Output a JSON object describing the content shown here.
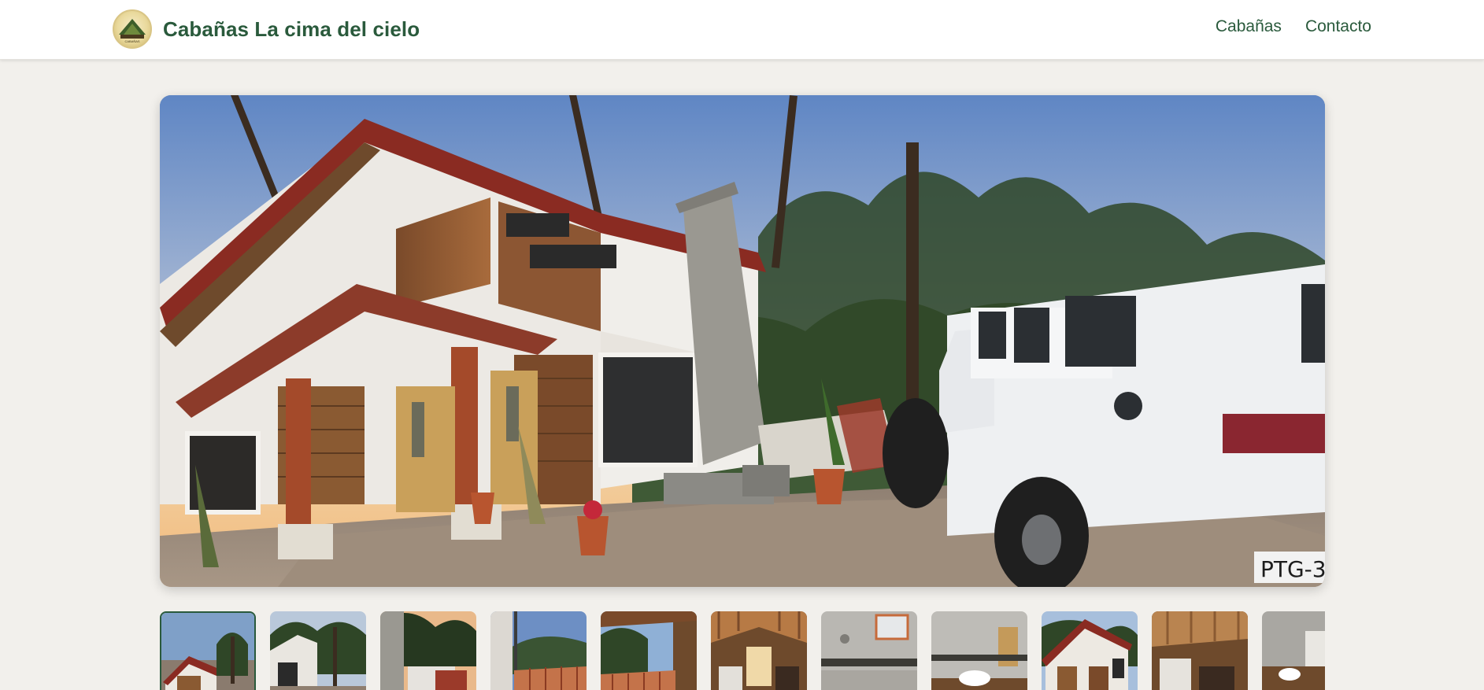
{
  "header": {
    "brand_name": "Cabañas La cima del cielo",
    "logo_text": "CABAÑAS",
    "nav": [
      {
        "label": "Cabañas"
      },
      {
        "label": "Contacto"
      }
    ]
  },
  "hero": {
    "plate_text": "PTG-3",
    "icon": "cabin-photo"
  },
  "gallery": {
    "thumbnail_count": 11,
    "active_index": 0
  },
  "colors": {
    "brand_green": "#2a5a3c",
    "page_background": "#f2f0ec",
    "header_background": "#ffffff"
  }
}
